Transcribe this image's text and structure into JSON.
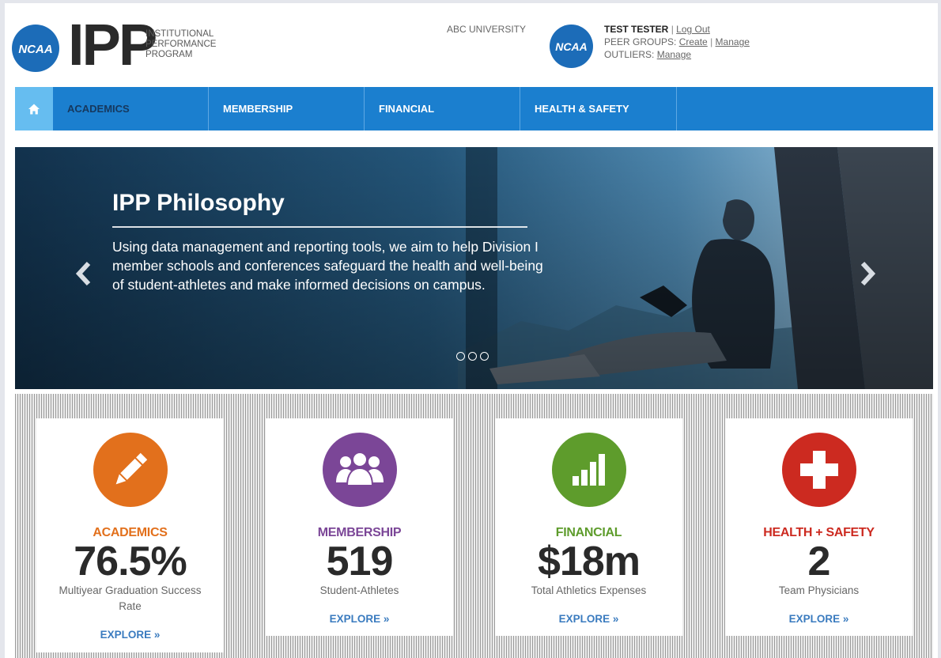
{
  "header": {
    "logo_text": "NCAA",
    "ipp_mark": "IPP",
    "program_lines": [
      "INSTITUTIONAL",
      "PERFORMANCE",
      "PROGRAM"
    ],
    "school_name": "ABC UNIVERSITY",
    "user_badge_text": "NCAA",
    "user_name": "TEST TESTER",
    "logout_label": "Log Out",
    "peer_groups_label": "PEER GROUPS:",
    "peer_create_label": "Create",
    "peer_manage_label": "Manage",
    "outliers_label": "OUTLIERS:",
    "outliers_manage_label": "Manage"
  },
  "nav": {
    "items": [
      {
        "label": "ACADEMICS"
      },
      {
        "label": "MEMBERSHIP"
      },
      {
        "label": "FINANCIAL"
      },
      {
        "label": "HEALTH & SAFETY"
      }
    ]
  },
  "hero": {
    "title": "IPP Philosophy",
    "text": "Using data management and reporting tools, we aim to help Division I member schools and conferences safeguard the health and well-being of student-athletes and make informed decisions on campus."
  },
  "stats": {
    "cards": [
      {
        "label": "ACADEMICS",
        "value": "76.5%",
        "desc": "Multiyear Graduation Success Rate",
        "explore": "EXPLORE »",
        "color": "#e2701c"
      },
      {
        "label": "MEMBERSHIP",
        "value": "519",
        "desc": "Student-Athletes",
        "explore": "EXPLORE »",
        "color": "#7b4697"
      },
      {
        "label": "FINANCIAL",
        "value": "$18m",
        "desc": "Total Athletics Expenses",
        "explore": "EXPLORE »",
        "color": "#5e9c2c"
      },
      {
        "label": "HEALTH + SAFETY",
        "value": "2",
        "desc": "Team Physicians",
        "explore": "EXPLORE »",
        "color": "#cc2a20"
      }
    ]
  },
  "colors": {
    "nav_blue": "#1b7fcf",
    "home_blue": "#66bdf0",
    "link_blue": "#3a7bbf",
    "brand_blue": "#1c6cb8"
  }
}
